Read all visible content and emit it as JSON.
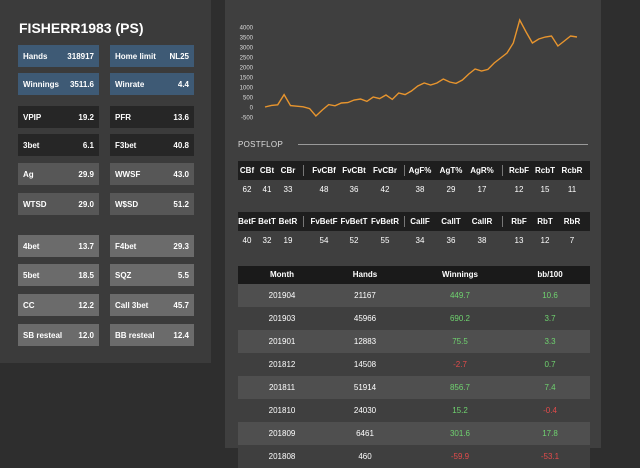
{
  "player": {
    "title": "FISHERR1983 (PS)"
  },
  "stats": [
    {
      "label": "Hands",
      "value": "318917"
    },
    {
      "label": "Home limit",
      "value": "NL25"
    },
    {
      "label": "Winnings",
      "value": "3511.6"
    },
    {
      "label": "Winrate",
      "value": "4.4"
    },
    {
      "label": "VPIP",
      "value": "19.2"
    },
    {
      "label": "PFR",
      "value": "13.6"
    },
    {
      "label": "3bet",
      "value": "6.1"
    },
    {
      "label": "F3bet",
      "value": "40.8"
    },
    {
      "label": "Ag",
      "value": "29.9"
    },
    {
      "label": "WWSF",
      "value": "43.0"
    },
    {
      "label": "WTSD",
      "value": "29.0"
    },
    {
      "label": "W$SD",
      "value": "51.2"
    },
    {
      "label": "4bet",
      "value": "13.7"
    },
    {
      "label": "F4bet",
      "value": "29.3"
    },
    {
      "label": "5bet",
      "value": "18.5"
    },
    {
      "label": "SQZ",
      "value": "5.5"
    },
    {
      "label": "CC",
      "value": "12.2"
    },
    {
      "label": "Call 3bet",
      "value": "45.7"
    },
    {
      "label": "SB resteal",
      "value": "12.0"
    },
    {
      "label": "BB resteal",
      "value": "12.4"
    }
  ],
  "chart_data": {
    "type": "line",
    "y_ticks": [
      "4000",
      "3500",
      "3000",
      "2500",
      "2000",
      "1500",
      "1000",
      "500",
      "0",
      "-500"
    ],
    "ylim": [
      -500,
      4000
    ],
    "series": [
      {
        "color": "#e8952e",
        "values": [
          0,
          80,
          110,
          620,
          70,
          40,
          10,
          -80,
          -450,
          -150,
          120,
          60,
          200,
          220,
          350,
          400,
          280,
          500,
          420,
          600,
          380,
          700,
          620,
          800,
          1050,
          1200,
          1100,
          1200,
          1400,
          1250,
          1180,
          1350,
          1650,
          1900,
          1800,
          1880,
          2200,
          2450,
          2700,
          3200,
          4350,
          3750,
          3200,
          3400,
          3500,
          3550,
          3050,
          3300,
          3550,
          3500
        ]
      }
    ]
  },
  "postflop": {
    "label": "POSTFLOP",
    "table1": {
      "headers": [
        "CBf",
        "CBt",
        "CBr",
        "FvCBf",
        "FvCBt",
        "FvCBr",
        "AgF%",
        "AgT%",
        "AgR%",
        "RcbF",
        "RcbT",
        "RcbR"
      ],
      "values": [
        "62",
        "41",
        "33",
        "48",
        "36",
        "42",
        "38",
        "29",
        "17",
        "12",
        "15",
        "11"
      ]
    },
    "table2": {
      "headers": [
        "BetF",
        "BetT",
        "BetR",
        "FvBetF",
        "FvBetT",
        "FvBetR",
        "CallF",
        "CallT",
        "CallR",
        "RbF",
        "RbT",
        "RbR"
      ],
      "values": [
        "40",
        "32",
        "19",
        "54",
        "52",
        "55",
        "34",
        "36",
        "38",
        "13",
        "12",
        "7"
      ]
    }
  },
  "months": {
    "headers": [
      "Month",
      "Hands",
      "Winnings",
      "bb/100"
    ],
    "rows": [
      {
        "month": "201904",
        "hands": "21167",
        "winnings": "449.7",
        "bb": "10.6"
      },
      {
        "month": "201903",
        "hands": "45966",
        "winnings": "690.2",
        "bb": "3.7"
      },
      {
        "month": "201901",
        "hands": "12883",
        "winnings": "75.5",
        "bb": "3.3"
      },
      {
        "month": "201812",
        "hands": "14508",
        "winnings": "-2.7",
        "bb": "0.7"
      },
      {
        "month": "201811",
        "hands": "51914",
        "winnings": "856.7",
        "bb": "7.4"
      },
      {
        "month": "201810",
        "hands": "24030",
        "winnings": "15.2",
        "bb": "-0.4"
      },
      {
        "month": "201809",
        "hands": "6461",
        "winnings": "301.6",
        "bb": "17.8"
      },
      {
        "month": "201808",
        "hands": "460",
        "winnings": "-59.9",
        "bb": "-53.1"
      }
    ]
  },
  "colors": {
    "positive": "#6fd36f",
    "negative": "#e24b4b",
    "line": "#e8952e",
    "stat_blue": "#3e5a75"
  }
}
